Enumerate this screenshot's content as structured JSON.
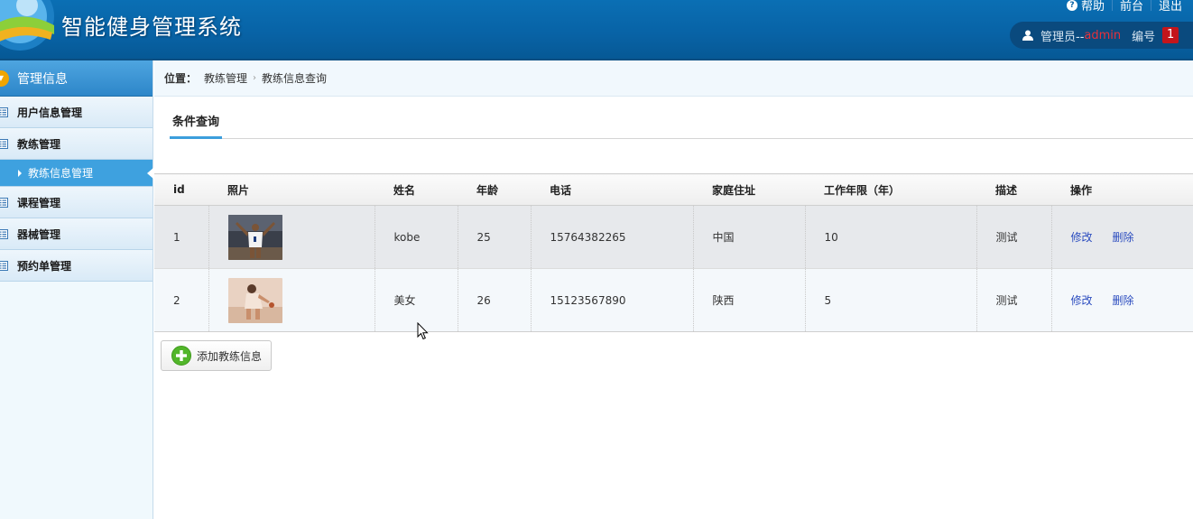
{
  "header": {
    "app_title": "智能健身管理系统",
    "links": [
      "帮助",
      "前台",
      "退出"
    ],
    "user_prefix": "管理员--",
    "user_name": "admin",
    "number_label": "编号",
    "number_value": "1"
  },
  "sidebar": {
    "title": "管理信息",
    "items": [
      {
        "label": "用户信息管理"
      },
      {
        "label": "教练管理"
      },
      {
        "label": "教练信息管理",
        "active": true
      },
      {
        "label": "课程管理"
      },
      {
        "label": "器械管理"
      },
      {
        "label": "预约单管理"
      }
    ]
  },
  "breadcrumb": {
    "label": "位置：",
    "items": [
      "教练管理",
      "教练信息查询"
    ]
  },
  "tabs": [
    "条件查询"
  ],
  "table": {
    "columns": [
      "id",
      "照片",
      "姓名",
      "年龄",
      "电话",
      "家庭住址",
      "工作年限（年）",
      "描述",
      "操作"
    ],
    "rows": [
      {
        "id": "1",
        "name": "kobe",
        "age": "25",
        "phone": "15764382265",
        "address": "中国",
        "years": "10",
        "desc": "测试",
        "edit": "修改",
        "delete": "删除"
      },
      {
        "id": "2",
        "name": "美女",
        "age": "26",
        "phone": "15123567890",
        "address": "陕西",
        "years": "5",
        "desc": "测试",
        "edit": "修改",
        "delete": "删除"
      }
    ]
  },
  "add_button": "添加教练信息",
  "colors": {
    "header_bg": "#0863a6",
    "sidebar_active": "#3ea1df",
    "badge": "#c3151b",
    "link": "#2b4cbf"
  }
}
